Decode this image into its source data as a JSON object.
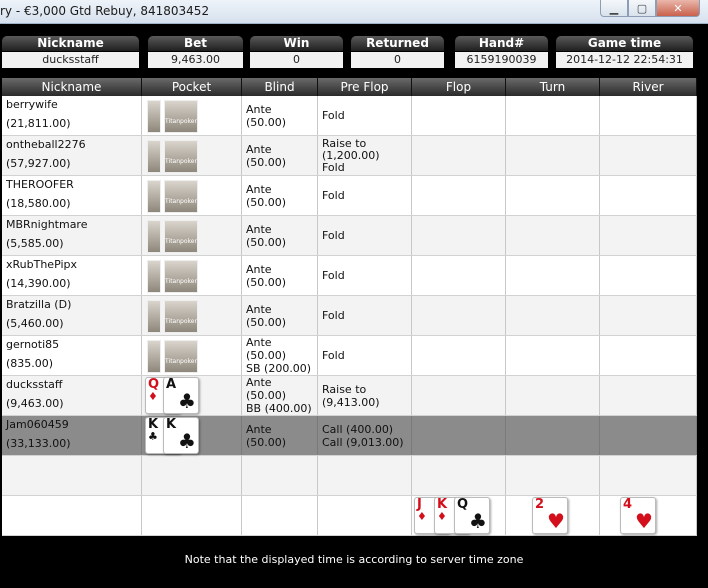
{
  "window": {
    "title": "ry - €3,000 Gtd Rebuy, 841803452"
  },
  "summary": {
    "nickname_label": "Nickname",
    "nickname": "ducksstaff",
    "bet_label": "Bet",
    "bet": "9,463.00",
    "win_label": "Win",
    "win": "0",
    "returned_label": "Returned",
    "returned": "0",
    "hand_label": "Hand#",
    "hand": "6159190039",
    "time_label": "Game time",
    "time": "2014-12-12 22:54:31"
  },
  "columns": [
    "Nickname",
    "Pocket",
    "Blind",
    "Pre Flop",
    "Flop",
    "Turn",
    "River"
  ],
  "cardback_brand": "Titanpoker",
  "players": [
    {
      "name": "berrywife",
      "stack": "(21,811.00)",
      "blind1": "Ante (50.00)",
      "blind2": "",
      "pre1": "Fold",
      "pre2": "",
      "pre3": ""
    },
    {
      "name": "ontheball2276",
      "stack": "(57,927.00)",
      "blind1": "Ante (50.00)",
      "blind2": "",
      "pre1": "Raise to",
      "pre2": "(1,200.00)",
      "pre3": "Fold"
    },
    {
      "name": "THEROOFER",
      "stack": "(18,580.00)",
      "blind1": "Ante (50.00)",
      "blind2": "",
      "pre1": "Fold",
      "pre2": "",
      "pre3": ""
    },
    {
      "name": "MBRnightmare",
      "stack": "(5,585.00)",
      "blind1": "Ante (50.00)",
      "blind2": "",
      "pre1": "Fold",
      "pre2": "",
      "pre3": ""
    },
    {
      "name": "xRubThePipx",
      "stack": "(14,390.00)",
      "blind1": "Ante (50.00)",
      "blind2": "",
      "pre1": "Fold",
      "pre2": "",
      "pre3": ""
    },
    {
      "name": "Bratzilla (D)",
      "stack": "(5,460.00)",
      "blind1": "Ante (50.00)",
      "blind2": "",
      "pre1": "Fold",
      "pre2": "",
      "pre3": ""
    },
    {
      "name": "gernoti85",
      "stack": "(835.00)",
      "blind1": "Ante (50.00)",
      "blind2": "SB (200.00)",
      "pre1": "Fold",
      "pre2": "",
      "pre3": ""
    },
    {
      "name": "ducksstaff",
      "stack": "(9,463.00)",
      "blind1": "Ante (50.00)",
      "blind2": "BB (400.00)",
      "pre1": "Raise to",
      "pre2": "(9,413.00)",
      "pre3": ""
    },
    {
      "name": "Jam060459",
      "stack": "(33,133.00)",
      "blind1": "Ante (50.00)",
      "blind2": "",
      "pre1": "Call (400.00)",
      "pre2": "Call (9,013.00)",
      "pre3": ""
    }
  ],
  "cards": {
    "ducksstaff_1": {
      "rank": "Q",
      "suit": "♦"
    },
    "ducksstaff_2": {
      "rank": "A",
      "suit": "♣"
    },
    "jam_1": {
      "rank": "K",
      "suit": "♣"
    },
    "jam_2": {
      "rank": "K",
      "suit": "♣"
    },
    "flop_1": {
      "rank": "J",
      "suit": "♦"
    },
    "flop_2": {
      "rank": "K",
      "suit": "♦"
    },
    "flop_3": {
      "rank": "Q",
      "suit": "♣"
    },
    "turn": {
      "rank": "2",
      "suit": "♥"
    },
    "river": {
      "rank": "4",
      "suit": "♥"
    }
  },
  "colors": {
    "red_suit": "#d30f1c",
    "selected_row": "#8b8b8b",
    "header": "#2a2a2a"
  },
  "footer": "Note that the displayed time is according to server time zone"
}
